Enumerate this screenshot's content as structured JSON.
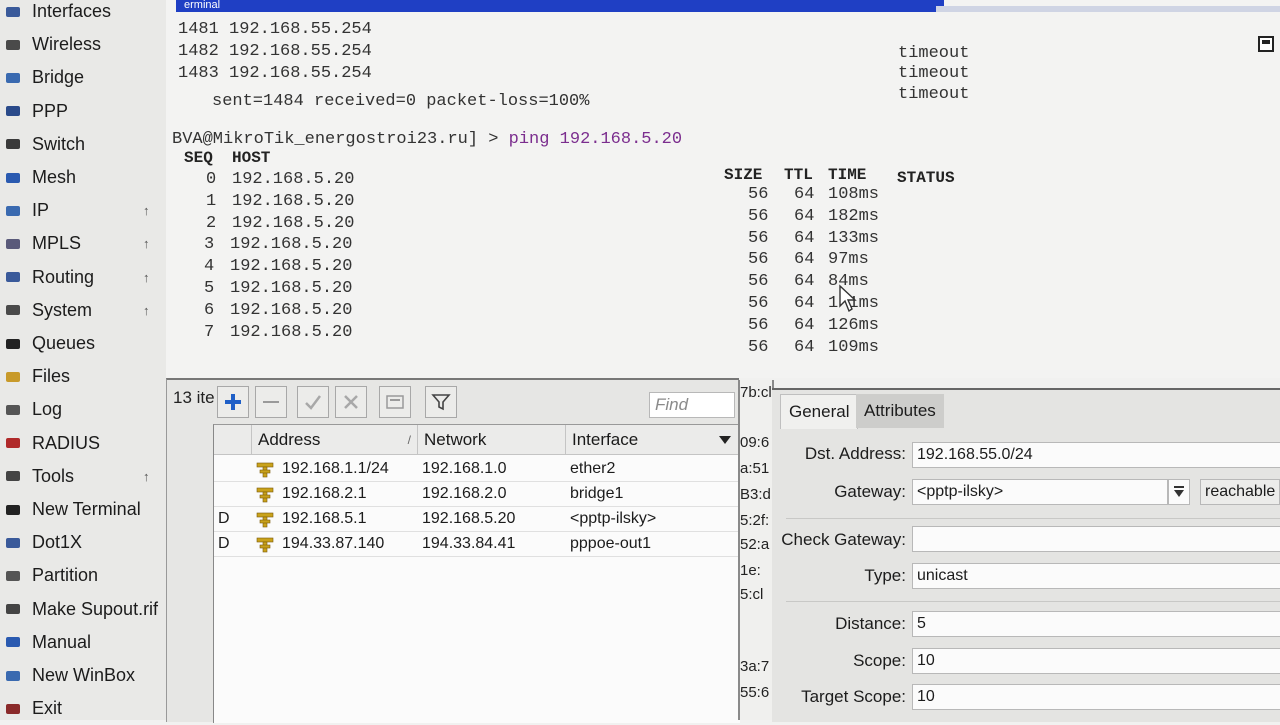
{
  "sidebar": {
    "items": [
      {
        "label": "Interfaces",
        "arrow": false,
        "icon": "interfaces-icon"
      },
      {
        "label": "Wireless",
        "arrow": false,
        "icon": "wireless-icon"
      },
      {
        "label": "Bridge",
        "arrow": false,
        "icon": "bridge-icon"
      },
      {
        "label": "PPP",
        "arrow": false,
        "icon": "ppp-icon"
      },
      {
        "label": "Switch",
        "arrow": false,
        "icon": "switch-icon"
      },
      {
        "label": "Mesh",
        "arrow": false,
        "icon": "mesh-icon"
      },
      {
        "label": "IP",
        "arrow": true,
        "icon": "ip-icon"
      },
      {
        "label": "MPLS",
        "arrow": true,
        "icon": "mpls-icon"
      },
      {
        "label": "Routing",
        "arrow": true,
        "icon": "routing-icon"
      },
      {
        "label": "System",
        "arrow": true,
        "icon": "system-icon"
      },
      {
        "label": "Queues",
        "arrow": false,
        "icon": "queues-icon"
      },
      {
        "label": "Files",
        "arrow": false,
        "icon": "files-icon"
      },
      {
        "label": "Log",
        "arrow": false,
        "icon": "log-icon"
      },
      {
        "label": "RADIUS",
        "arrow": false,
        "icon": "radius-icon"
      },
      {
        "label": "Tools",
        "arrow": true,
        "icon": "tools-icon"
      },
      {
        "label": "New Terminal",
        "arrow": false,
        "icon": "terminal-icon"
      },
      {
        "label": "Dot1X",
        "arrow": false,
        "icon": "dot1x-icon"
      },
      {
        "label": "Partition",
        "arrow": false,
        "icon": "partition-icon"
      },
      {
        "label": "Make Supout.rif",
        "arrow": false,
        "icon": "supout-icon"
      },
      {
        "label": "Manual",
        "arrow": false,
        "icon": "manual-icon"
      },
      {
        "label": "New WinBox",
        "arrow": false,
        "icon": "winbox-icon"
      },
      {
        "label": "Exit",
        "arrow": false,
        "icon": "exit-icon"
      }
    ],
    "submenu_arrow": "↑"
  },
  "terminal": {
    "title": "erminal",
    "prev_ping_rows": [
      {
        "seq": "1481",
        "host": "192.168.55.254"
      },
      {
        "seq": "1482",
        "host": "192.168.55.254"
      },
      {
        "seq": "1483",
        "host": "192.168.55.254"
      }
    ],
    "timeouts": [
      "timeout",
      "timeout",
      "timeout"
    ],
    "summary": "sent=1484 received=0 packet-loss=100%",
    "prompt": "BVA@MikroTik_energostroi23.ru] > ",
    "command": "ping 192.168.5.20",
    "headers": {
      "seq": "SEQ",
      "host": "HOST",
      "size": "SIZE",
      "ttl": "TTL",
      "time": "TIME",
      "status": "STATUS"
    },
    "ping_rows": [
      {
        "seq": "0",
        "host": "192.168.5.20",
        "size": "56",
        "ttl": "64",
        "time": "108ms"
      },
      {
        "seq": "1",
        "host": "192.168.5.20",
        "size": "56",
        "ttl": "64",
        "time": "182ms"
      },
      {
        "seq": "2",
        "host": "192.168.5.20",
        "size": "56",
        "ttl": "64",
        "time": "133ms"
      },
      {
        "seq": "3",
        "host": "192.168.5.20",
        "size": "56",
        "ttl": "64",
        "time": "97ms"
      },
      {
        "seq": "4",
        "host": "192.168.5.20",
        "size": "56",
        "ttl": "64",
        "time": "84ms"
      },
      {
        "seq": "5",
        "host": "192.168.5.20",
        "size": "56",
        "ttl": "64",
        "time": "1 1ms"
      },
      {
        "seq": "6",
        "host": "192.168.5.20",
        "size": "56",
        "ttl": "64",
        "time": "126ms"
      },
      {
        "seq": "7",
        "host": "192.168.5.20",
        "size": "56",
        "ttl": "64",
        "time": "109ms"
      }
    ]
  },
  "addresses": {
    "count_label": "13 ite",
    "find_placeholder": "Find",
    "columns": {
      "address": "Address",
      "network": "Network",
      "interface": "Interface"
    },
    "rows": [
      {
        "flag": "",
        "address": "192.168.1.1/24",
        "network": "192.168.1.0",
        "interface": "ether2"
      },
      {
        "flag": "",
        "address": "192.168.2.1",
        "network": "192.168.2.0",
        "interface": "bridge1"
      },
      {
        "flag": "D",
        "address": "192.168.5.1",
        "network": "192.168.5.20",
        "interface": "<pptp-ilsky>"
      },
      {
        "flag": "D",
        "address": "194.33.87.140",
        "network": "194.33.84.41",
        "interface": "pppoe-out1"
      }
    ]
  },
  "mac_fragments": [
    "7b:cl",
    "09:6",
    "a:51",
    "B3:d",
    "5:2f:",
    "52:a",
    "1e:",
    "5:cl",
    "3a:7",
    "55:6"
  ],
  "route": {
    "tabs": {
      "general": "General",
      "attributes": "Attributes"
    },
    "dst_address": {
      "label": "Dst. Address:",
      "value": "192.168.55.0/24"
    },
    "gateway": {
      "label": "Gateway:",
      "value": "<pptp-ilsky>",
      "state": "reachable"
    },
    "check_gateway": {
      "label": "Check Gateway:",
      "value": ""
    },
    "type": {
      "label": "Type:",
      "value": "unicast"
    },
    "distance": {
      "label": "Distance:",
      "value": "5"
    },
    "scope": {
      "label": "Scope:",
      "value": "10"
    },
    "target_scope": {
      "label": "Target Scope:",
      "value": "10"
    }
  },
  "colors": {
    "title_bar": "#1f3fc4",
    "prompt": "#7b2d8e",
    "add_button": "#1f5fc7",
    "address_icon": "#c9a21a"
  }
}
